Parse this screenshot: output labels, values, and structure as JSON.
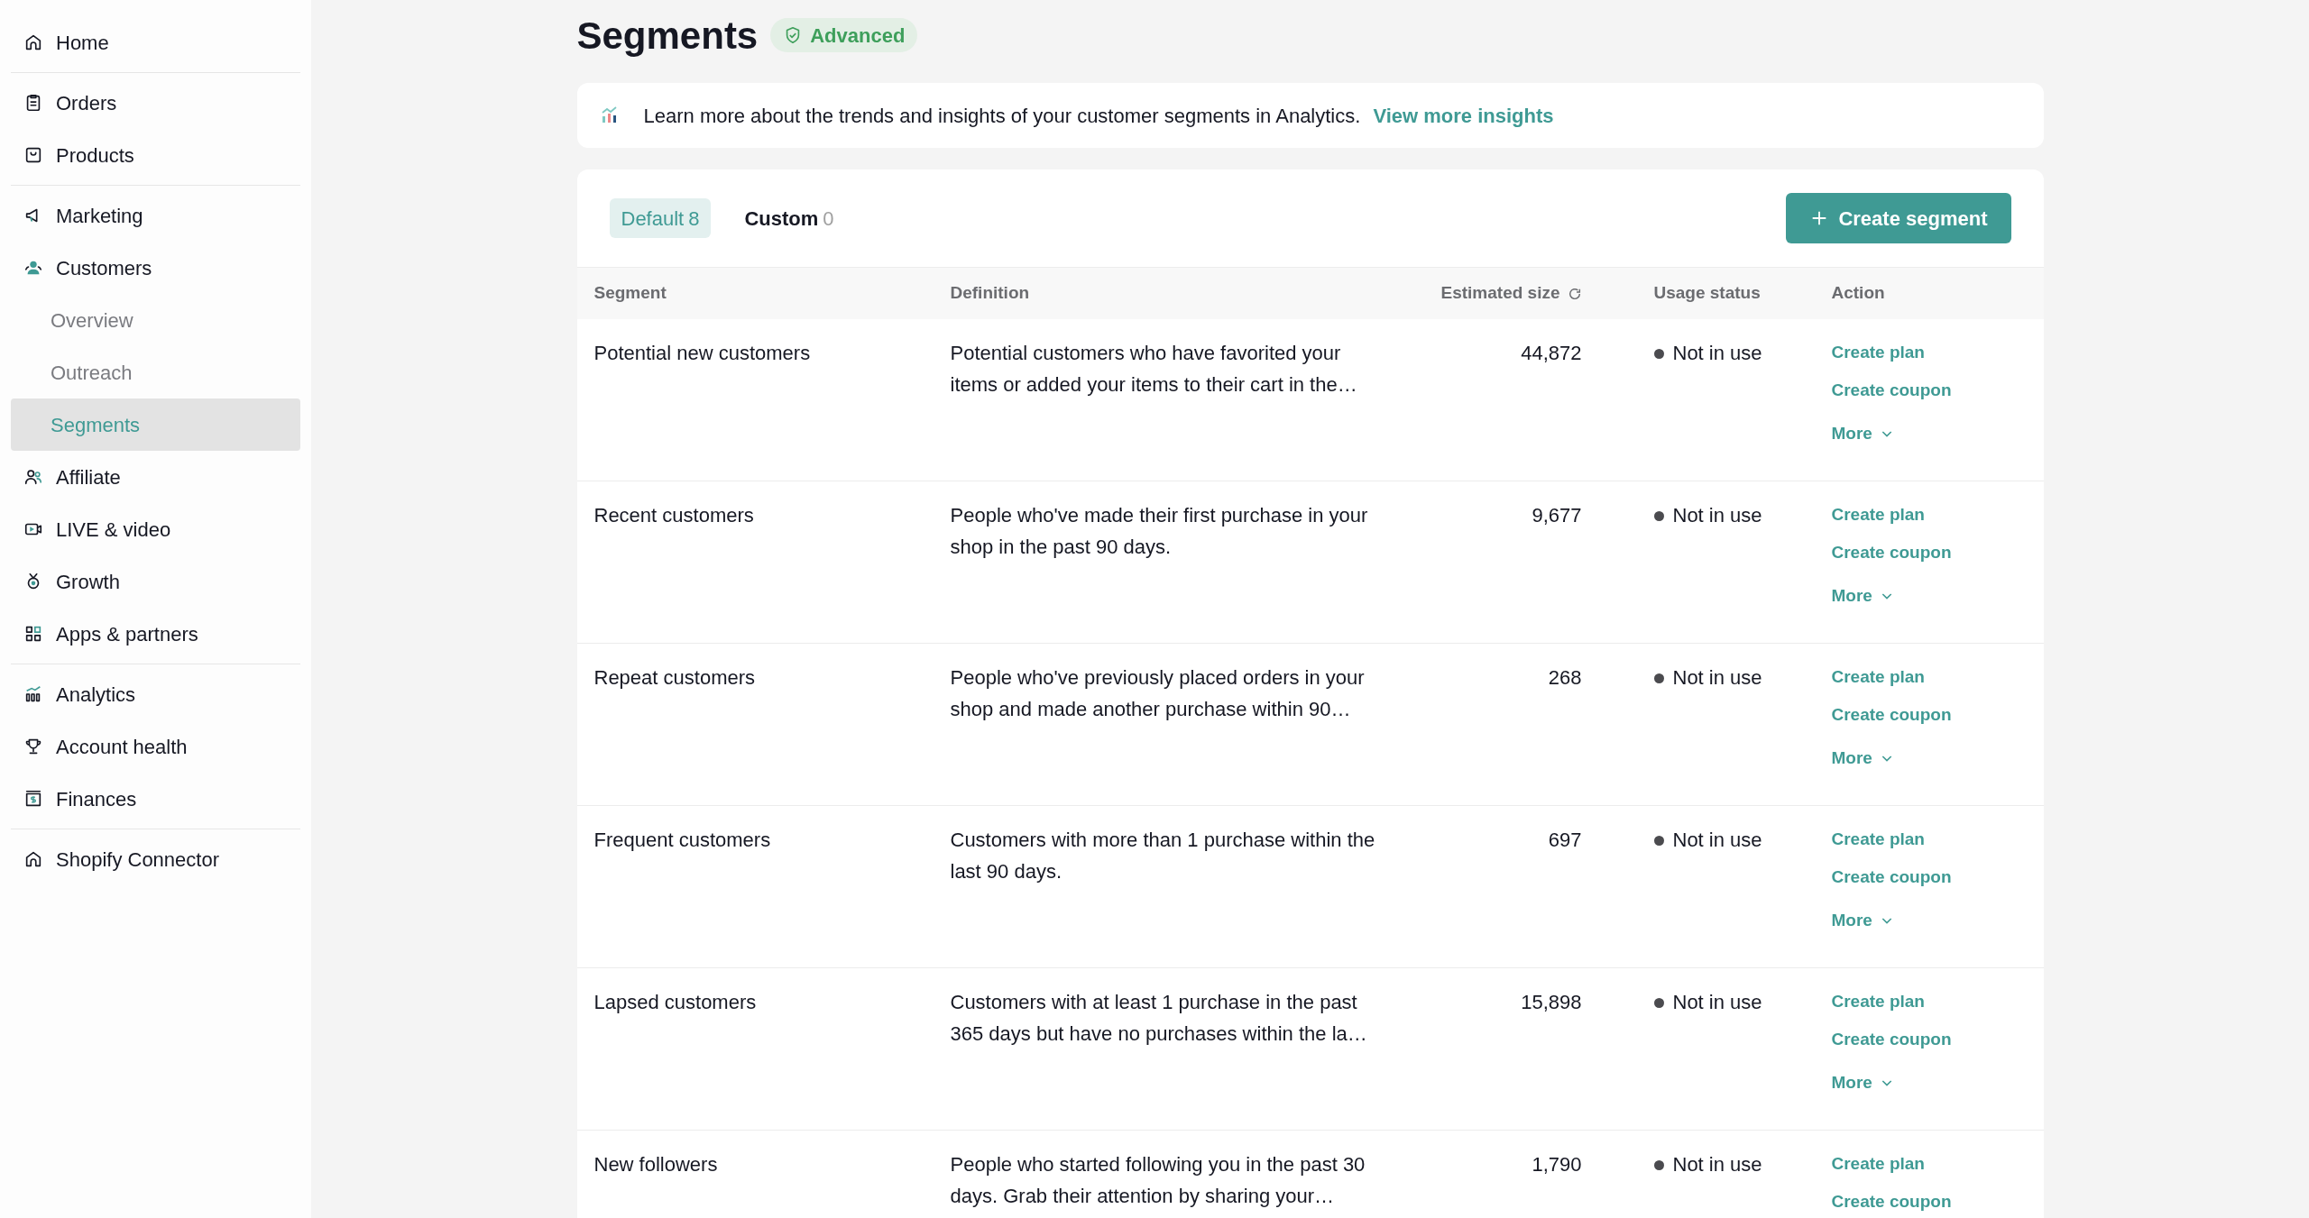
{
  "sidebar": {
    "groups": [
      [
        {
          "label": "Home",
          "selected": false
        }
      ],
      [
        {
          "label": "Orders",
          "selected": false
        },
        {
          "label": "Products",
          "selected": false
        }
      ],
      [
        {
          "label": "Marketing",
          "selected": false
        },
        {
          "label": "Customers",
          "selected": false,
          "children": [
            {
              "label": "Overview",
              "selected": false
            },
            {
              "label": "Outreach",
              "selected": false
            },
            {
              "label": "Segments",
              "selected": true
            }
          ]
        },
        {
          "label": "Affiliate",
          "selected": false
        },
        {
          "label": "LIVE & video",
          "selected": false
        },
        {
          "label": "Growth",
          "selected": false
        },
        {
          "label": "Apps & partners",
          "selected": false
        }
      ],
      [
        {
          "label": "Analytics",
          "selected": false
        },
        {
          "label": "Account health",
          "selected": false
        },
        {
          "label": "Finances",
          "selected": false
        }
      ],
      [
        {
          "label": "Shopify Connector",
          "selected": false
        }
      ]
    ]
  },
  "page": {
    "title": "Segments",
    "badge": "Advanced"
  },
  "banner": {
    "text": "Learn more about the trends and insights of your customer segments in Analytics.",
    "link": "View more insights"
  },
  "tabs": [
    {
      "label": "Default",
      "count": "8",
      "selected": true
    },
    {
      "label": "Custom",
      "count": "0",
      "selected": false
    }
  ],
  "create_button": "Create segment",
  "table": {
    "columns": [
      "Segment",
      "Definition",
      "Estimated size",
      "Usage status",
      "Action"
    ],
    "rows": [
      {
        "segment": "Potential new customers",
        "definition": "Potential customers who have favorited your items or added your items to their cart in the…",
        "size": "44,872",
        "status": "Not in use",
        "actions": [
          "Create plan",
          "Create coupon"
        ],
        "more": "More"
      },
      {
        "segment": "Recent customers",
        "definition": "People who've made their first purchase in your shop in the past 90 days.",
        "size": "9,677",
        "status": "Not in use",
        "actions": [
          "Create plan",
          "Create coupon"
        ],
        "more": "More"
      },
      {
        "segment": "Repeat customers",
        "definition": "People who've previously placed orders in your shop and made another purchase within 90…",
        "size": "268",
        "status": "Not in use",
        "actions": [
          "Create plan",
          "Create coupon"
        ],
        "more": "More"
      },
      {
        "segment": "Frequent customers",
        "definition": "Customers with more than 1 purchase within the last 90 days.",
        "size": "697",
        "status": "Not in use",
        "actions": [
          "Create plan",
          "Create coupon"
        ],
        "more": "More"
      },
      {
        "segment": "Lapsed customers",
        "definition": "Customers with at least 1 purchase in the past 365 days but have no purchases within the la…",
        "size": "15,898",
        "status": "Not in use",
        "actions": [
          "Create plan",
          "Create coupon"
        ],
        "more": "More"
      },
      {
        "segment": "New followers",
        "definition": "People who started following you in the past 30 days. Grab their attention by sharing your…",
        "size": "1,790",
        "status": "Not in use",
        "actions": [
          "Create plan",
          "Create coupon"
        ]
      }
    ]
  }
}
